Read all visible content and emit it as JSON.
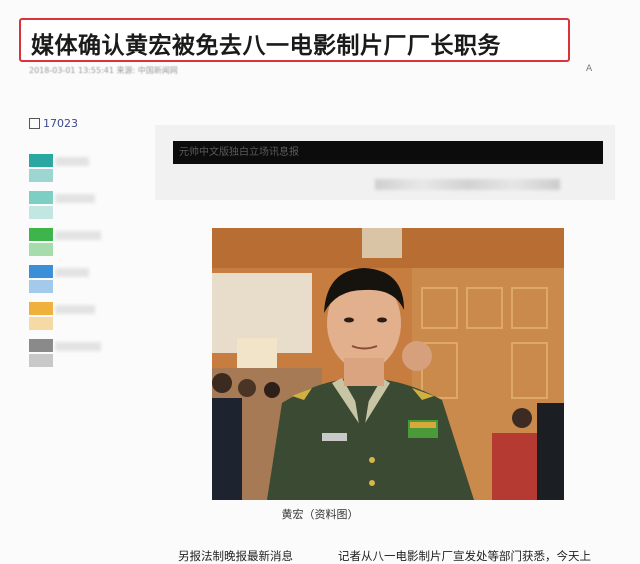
{
  "headline": "媒体确认黄宏被免去八一电影制片厂厂长职务",
  "meta": {
    "left": "2018-03-01 13:55:41  来源: 中国新闻网",
    "right": "A"
  },
  "sidebar": {
    "views": "17023",
    "share_colors": [
      "#2aa7a0",
      "#7dcfc4",
      "#3db54a",
      "#3a8fd8",
      "#efb13b",
      "#8a8a8a"
    ]
  },
  "card": {
    "blurred_title": "元帅中文版独白立场讯息报"
  },
  "photo": {
    "caption": "黄宏（资料图）"
  },
  "footer": {
    "left": "另报法制晚报最新消息",
    "right": "记者从八一电影制片厂宣发处等部门获悉，今天上"
  }
}
